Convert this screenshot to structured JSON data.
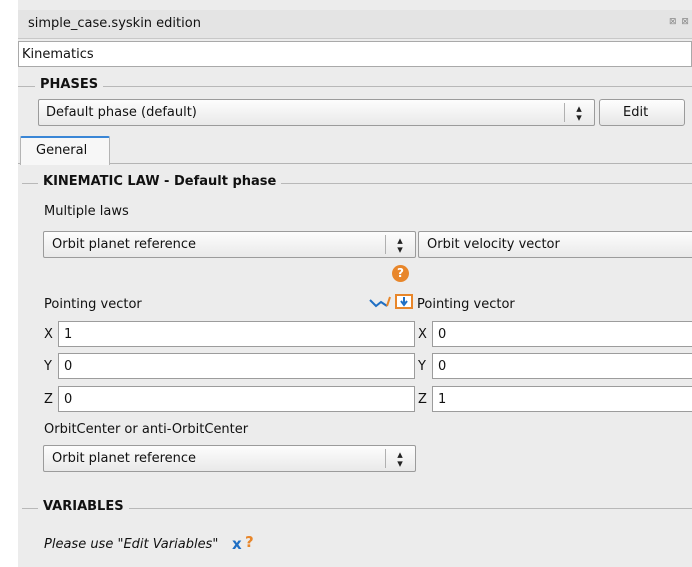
{
  "window": {
    "title": "simple_case.syskin edition",
    "window_icons": "⊠ ⊠"
  },
  "mode_field": {
    "value": "Kinematics"
  },
  "phases": {
    "title": "PHASES",
    "selected": "Default phase (default)",
    "edit_label": "Edit"
  },
  "tabs": [
    {
      "label": "General"
    }
  ],
  "kinematic_law": {
    "title": "KINEMATIC LAW - Default phase",
    "multiple_laws_label": "Multiple laws",
    "left_reference": "Orbit planet reference",
    "right_reference": "Orbit velocity vector",
    "help_glyph": "?",
    "left_vector_label": "Pointing vector",
    "right_vector_label": "Pointing vector",
    "left_vector": {
      "x_label": "X",
      "x": "1",
      "y_label": "Y",
      "y": "0",
      "z_label": "Z",
      "z": "0"
    },
    "right_vector": {
      "x_label": "X",
      "x": "0",
      "y_label": "Y",
      "y": "0",
      "z_label": "Z",
      "z": "1"
    },
    "orbit_center_label": "OrbitCenter or anti-OrbitCenter",
    "orbit_center_value": "Orbit planet reference"
  },
  "variables": {
    "title": "VARIABLES",
    "hint": "Please use \"Edit Variables\"",
    "x_glyph": "x",
    "q_glyph": "?"
  },
  "colors": {
    "tab_accent": "#3a86d6",
    "help_orange": "#e8862a",
    "icon_blue": "#1f6fc4"
  }
}
